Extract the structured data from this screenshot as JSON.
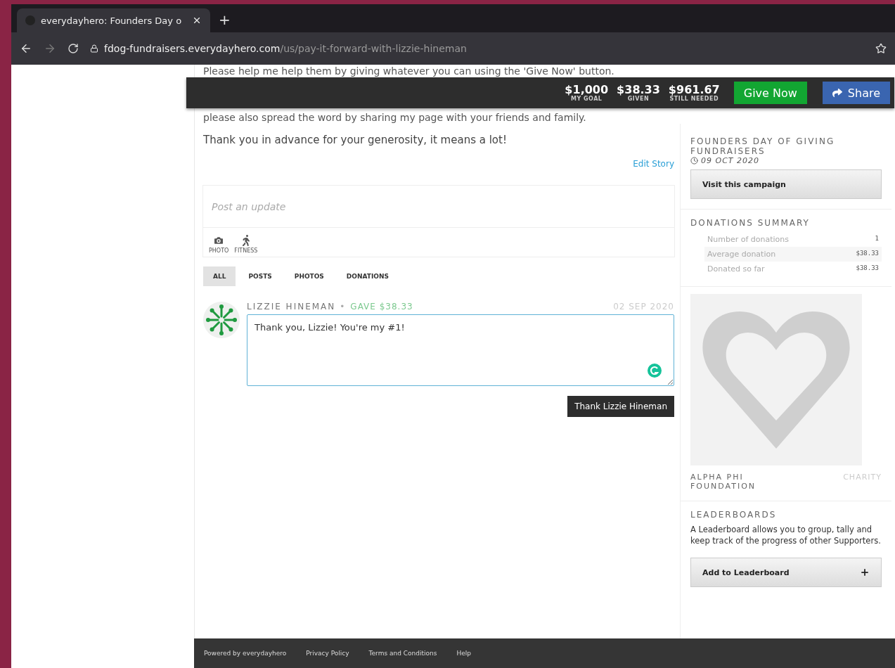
{
  "browser": {
    "tab_title": "everydayhero: Founders Day o",
    "new_tab": "+",
    "url_domain": "fdog-fundraisers.everydayhero.com",
    "url_path": "/us/pay-it-forward-with-lizzie-hineman"
  },
  "story": {
    "lines": [
      "Please help me help them by giving whatever you can using the 'Give Now' button.",
      "please also spread the word by sharing my page with your friends and family."
    ],
    "closing": "Thank you in advance for your generosity, it means a lot!",
    "edit_link": "Edit Story"
  },
  "stats_bar": {
    "stats": [
      {
        "value": "$1,000",
        "label": "MY GOAL"
      },
      {
        "value": "$38.33",
        "label": "GIVEN"
      },
      {
        "value": "$961.67",
        "label": "STILL NEEDED"
      }
    ],
    "give_button": "Give Now",
    "share_button": "Share"
  },
  "composer": {
    "placeholder": "Post an update",
    "attachments": [
      {
        "kind": "photo",
        "label": "PHOTO"
      },
      {
        "kind": "fitness",
        "label": "FITNESS"
      }
    ]
  },
  "feed_tabs": [
    {
      "label": "ALL",
      "selected": true
    },
    {
      "label": "POSTS",
      "selected": false
    },
    {
      "label": "PHOTOS",
      "selected": false
    },
    {
      "label": "DONATIONS",
      "selected": false
    }
  ],
  "donation": {
    "name": "LIZZIE HINEMAN",
    "separator": "•",
    "gave": "GAVE $38.33",
    "date": "02 SEP 2020",
    "reply": "Thank you, Lizzie! You're my #1!",
    "thank_button": "Thank Lizzie Hineman"
  },
  "campaign": {
    "title": "FOUNDERS DAY OF GIVING FUNDRAISERS",
    "date": "09 OCT 2020",
    "button": "Visit this campaign"
  },
  "summary": {
    "title": "DONATIONS SUMMARY",
    "rows": [
      {
        "label": "Number of donations",
        "value": "1"
      },
      {
        "label": "Average donation",
        "value": "$38.33"
      },
      {
        "label": "Donated so far",
        "value": "$38.33"
      }
    ]
  },
  "charity": {
    "name": "ALPHA PHI FOUNDATION",
    "type": "CHARITY"
  },
  "leaderboards": {
    "title": "LEADERBOARDS",
    "text": "A Leaderboard allows you to group, tally and keep track of the progress of other Supporters.",
    "button": "Add to Leaderboard"
  },
  "footer": {
    "links": [
      "Powered by everydayhero",
      "Privacy Policy",
      "Terms and Conditions",
      "Help"
    ]
  }
}
